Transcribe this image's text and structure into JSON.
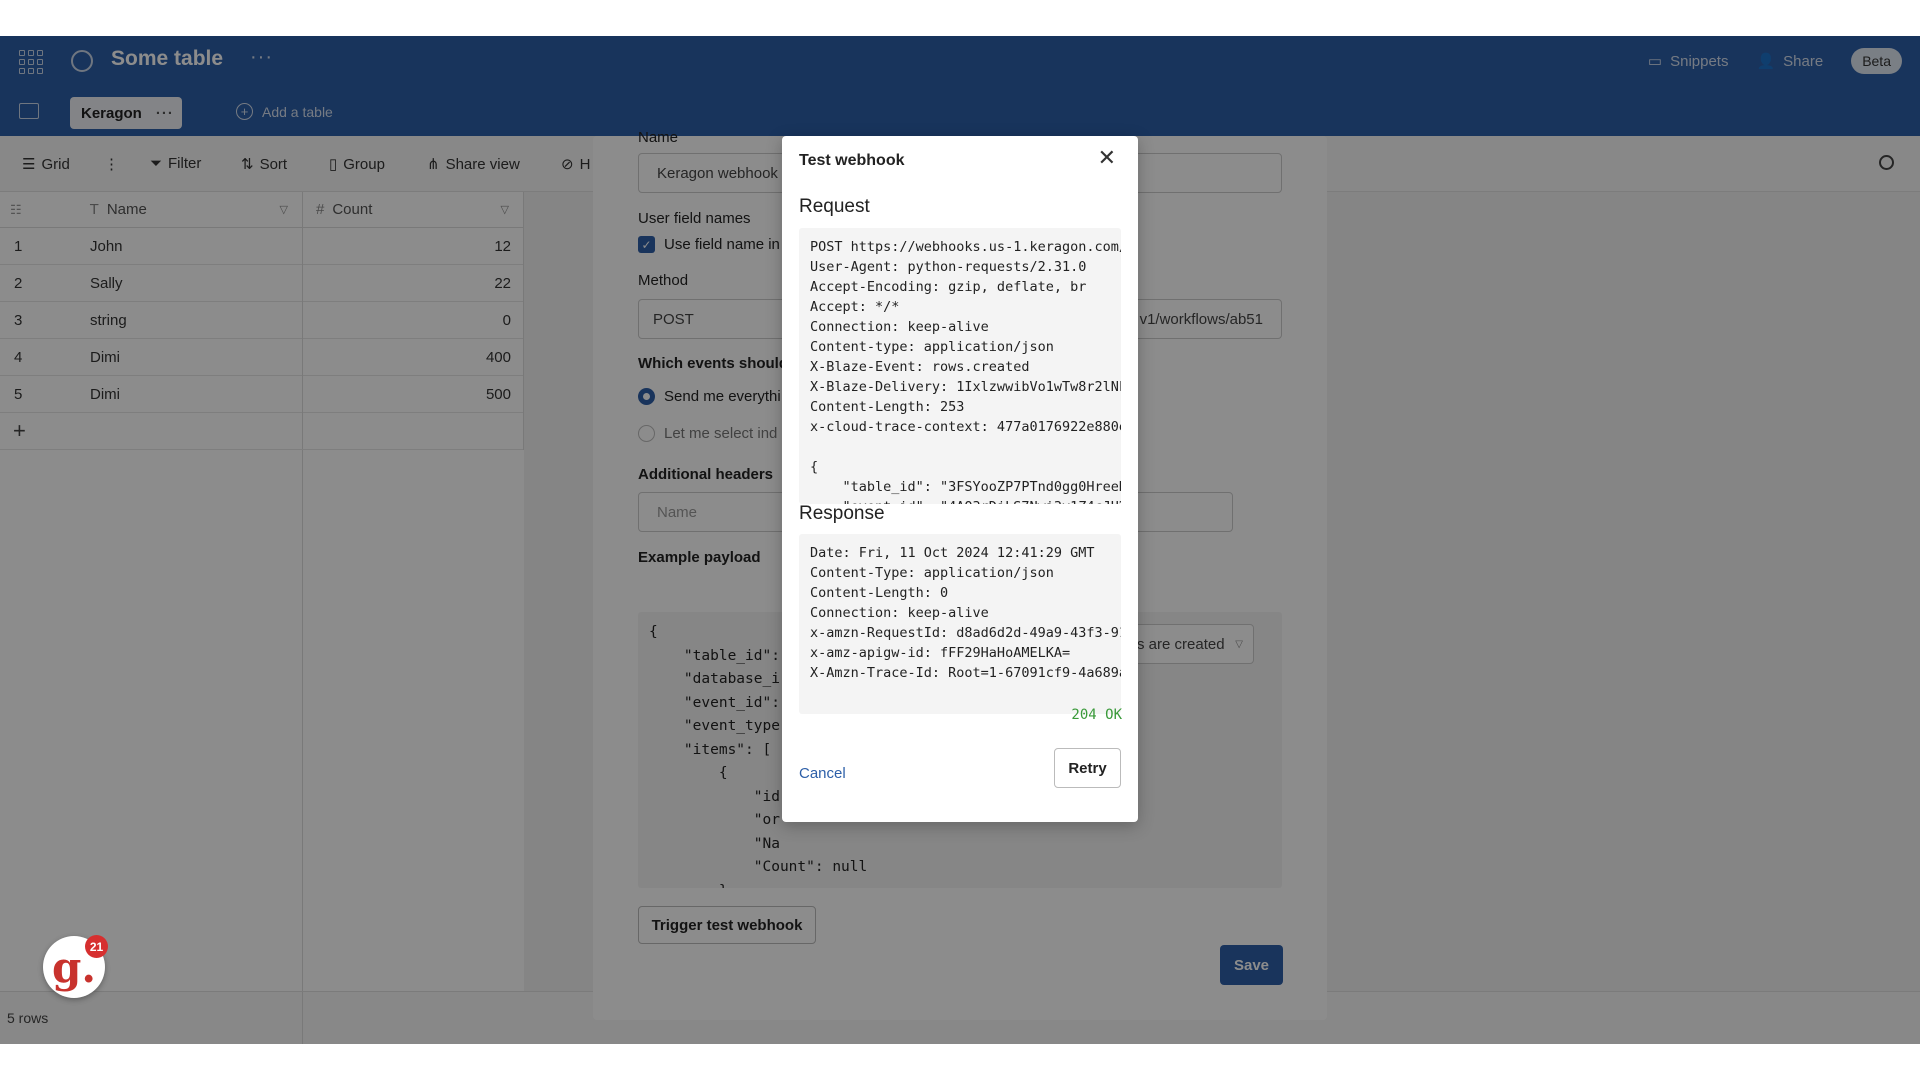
{
  "header": {
    "table_title": "Some table",
    "more": "···",
    "snippets": "Snippets",
    "share": "Share",
    "beta": "Beta"
  },
  "tabs": {
    "active": "Keragon",
    "more": "···",
    "add_table": "Add a table"
  },
  "toolbar": {
    "grid": "Grid",
    "filter": "Filter",
    "sort": "Sort",
    "group": "Group",
    "share_view": "Share view",
    "hide": "H"
  },
  "table": {
    "columns": [
      {
        "label": "Name",
        "type_icon": "T"
      },
      {
        "label": "Count",
        "type_icon": "#"
      }
    ],
    "rows": [
      {
        "id": "1",
        "name": "John",
        "count": "12"
      },
      {
        "id": "2",
        "name": "Sally",
        "count": "22"
      },
      {
        "id": "3",
        "name": "string",
        "count": "0"
      },
      {
        "id": "4",
        "name": "Dimi",
        "count": "400"
      },
      {
        "id": "5",
        "name": "Dimi",
        "count": "500"
      }
    ],
    "row_count": "5 rows"
  },
  "webhook_form": {
    "name_label": "Name",
    "name_value": "Keragon webhook",
    "user_field_names_label": "User field names",
    "use_field_names": "Use field name in",
    "method_label": "Method",
    "method_value": "POST",
    "url_value": "v1/workflows/ab51",
    "events_label": "Which events should",
    "send_everything": "Send me everythi",
    "let_me_select": "Let me select ind",
    "event_select": "s are created",
    "additional_headers_label": "Additional headers",
    "header_name_placeholder": "Name",
    "example_payload_label": "Example payload",
    "payload": "{\n    \"table_id\":\n    \"database_i\n    \"event_id\":\n    \"event_type\n    \"items\": [\n        {\n            \"id\n            \"or\n            \"Na\n            \"Count\": null\n        },",
    "trigger_button": "Trigger test webhook",
    "save_button": "Save"
  },
  "modal": {
    "title": "Test webhook",
    "request_title": "Request",
    "request_body": "POST https://webhooks.us-1.keragon.com/\nUser-Agent: python-requests/2.31.0\nAccept-Encoding: gzip, deflate, br\nAccept: */*\nConnection: keep-alive\nContent-type: application/json\nX-Blaze-Event: rows.created\nX-Blaze-Delivery: 1IxlzwwibVo1wTw8r2lNF\nContent-Length: 253\nx-cloud-trace-context: 477a0176922e880e\n\n{\n    \"table_id\": \"3FSYooZP7PTnd0gg0HreeD\n    \"event_id\": \"4AQ3rDjLS7Nwi3y1Z4cJUD3",
    "response_title": "Response",
    "response_body": "Date: Fri, 11 Oct 2024 12:41:29 GMT\nContent-Type: application/json\nContent-Length: 0\nConnection: keep-alive\nx-amzn-RequestId: d8ad6d2d-49a9-43f3-91\nx-amz-apigw-id: fFF29HaHoAMELKA=\nX-Amzn-Trace-Id: Root=1-67091cf9-4a689a",
    "status": "204 OK",
    "cancel": "Cancel",
    "retry": "Retry"
  },
  "notification": {
    "logo_letter": "g.",
    "badge": "21"
  },
  "colors": {
    "brand": "#2d5fa8",
    "status_ok": "#3a9a3a",
    "badge": "#d62f2f"
  }
}
